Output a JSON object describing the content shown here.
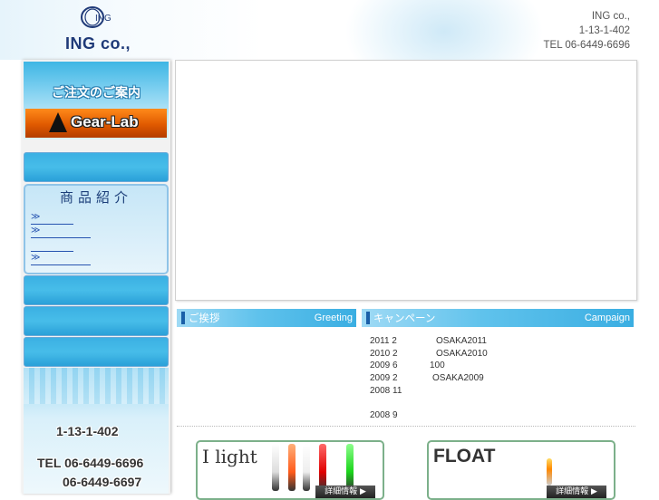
{
  "header": {
    "logo_text": "ING co.,",
    "logo_mark_text": "ING",
    "company_lines": [
      "ING co.,",
      "1-13-1-402",
      "TEL 06-6449-6696"
    ]
  },
  "sidebar": {
    "order_title": "ご注文のご案内",
    "gear_lab_label": "Gear-Lab",
    "products_title": "商品紹介",
    "product_links": [
      "≫",
      "≫",
      "",
      "≫"
    ],
    "address": [
      "1-13-1-402",
      "TEL  06-6449-6696",
      "06-6449-6697"
    ]
  },
  "greeting": {
    "title_jp": "ご挨拶",
    "title_en": "Greeting"
  },
  "campaign": {
    "title_jp": "キャンペーン",
    "title_en": "Campaign",
    "items": [
      {
        "date": "2011 2",
        "text": "OSAKA2011"
      },
      {
        "date": "2010 2",
        "text": "OSAKA2010"
      },
      {
        "date": "2009 6",
        "text": "100"
      },
      {
        "date": "2009 2",
        "text": "OSAKA2009"
      },
      {
        "date": "2008 11",
        "text": ""
      },
      {
        "date": "",
        "text": ""
      },
      {
        "date": "2008 9",
        "text": ""
      }
    ]
  },
  "banners": [
    {
      "title": "I light",
      "button": "詳細情報 ▶"
    },
    {
      "title": "FLOAT",
      "button": "詳細情報 ▶"
    }
  ],
  "colors": {
    "sidebar_button": "#3bb0e3",
    "section_header": "#5fc2ec",
    "logo_blue": "#1f3a78",
    "gear_lab_orange": "#e05a00"
  }
}
